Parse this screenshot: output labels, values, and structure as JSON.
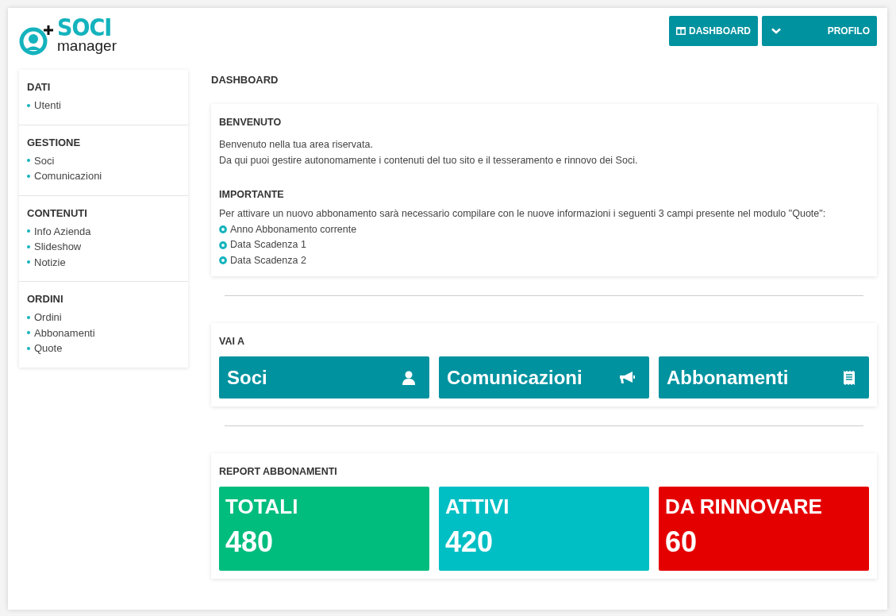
{
  "logo": {
    "title": "SOCI",
    "subtitle": "manager"
  },
  "header_buttons": [
    {
      "label": "DASHBOARD",
      "kind": "dashboard"
    },
    {
      "label": "PROFILO",
      "kind": "dropdown"
    }
  ],
  "sidebar": {
    "sections": [
      {
        "title": "DATI",
        "items": [
          "Utenti"
        ]
      },
      {
        "title": "GESTIONE",
        "items": [
          "Soci",
          "Comunicazioni"
        ]
      },
      {
        "title": "CONTENUTI",
        "items": [
          "Info Azienda",
          "Slideshow",
          "Notizie"
        ]
      },
      {
        "title": "ORDINI",
        "items": [
          "Ordini",
          "Abbonamenti",
          "Quote"
        ]
      }
    ]
  },
  "page_title": "DASHBOARD",
  "welcome": {
    "title": "BENVENUTO",
    "lines": [
      "Benvenuto nella tua area riservata.",
      "Da qui puoi gestire autonomamente i contenuti del tuo sito e il tesseramento e rinnovo dei Soci."
    ],
    "important_title": "IMPORTANTE",
    "important_text": "Per attivare un nuovo abbonamento sarà necessario compilare con le nuove informazioni i seguenti 3 campi presente nel modulo \"Quote\":",
    "fields": [
      "Anno Abbonamento corrente",
      "Data Scadenza 1",
      "Data Scadenza 2"
    ]
  },
  "goto": {
    "title": "VAI A",
    "links": [
      {
        "label": "Soci",
        "kind": "person"
      },
      {
        "label": "Comunicazioni",
        "kind": "megaphone"
      },
      {
        "label": "Abbonamenti",
        "kind": "receipt"
      }
    ]
  },
  "report": {
    "title": "REPORT ABBONAMENTI",
    "cards": [
      {
        "label": "TOTALI",
        "value": "480",
        "color": "#00bd7e"
      },
      {
        "label": "ATTIVI",
        "value": "420",
        "color": "#00bfc4"
      },
      {
        "label": "DA RINNOVARE",
        "value": "60",
        "color": "#e50000"
      }
    ]
  }
}
